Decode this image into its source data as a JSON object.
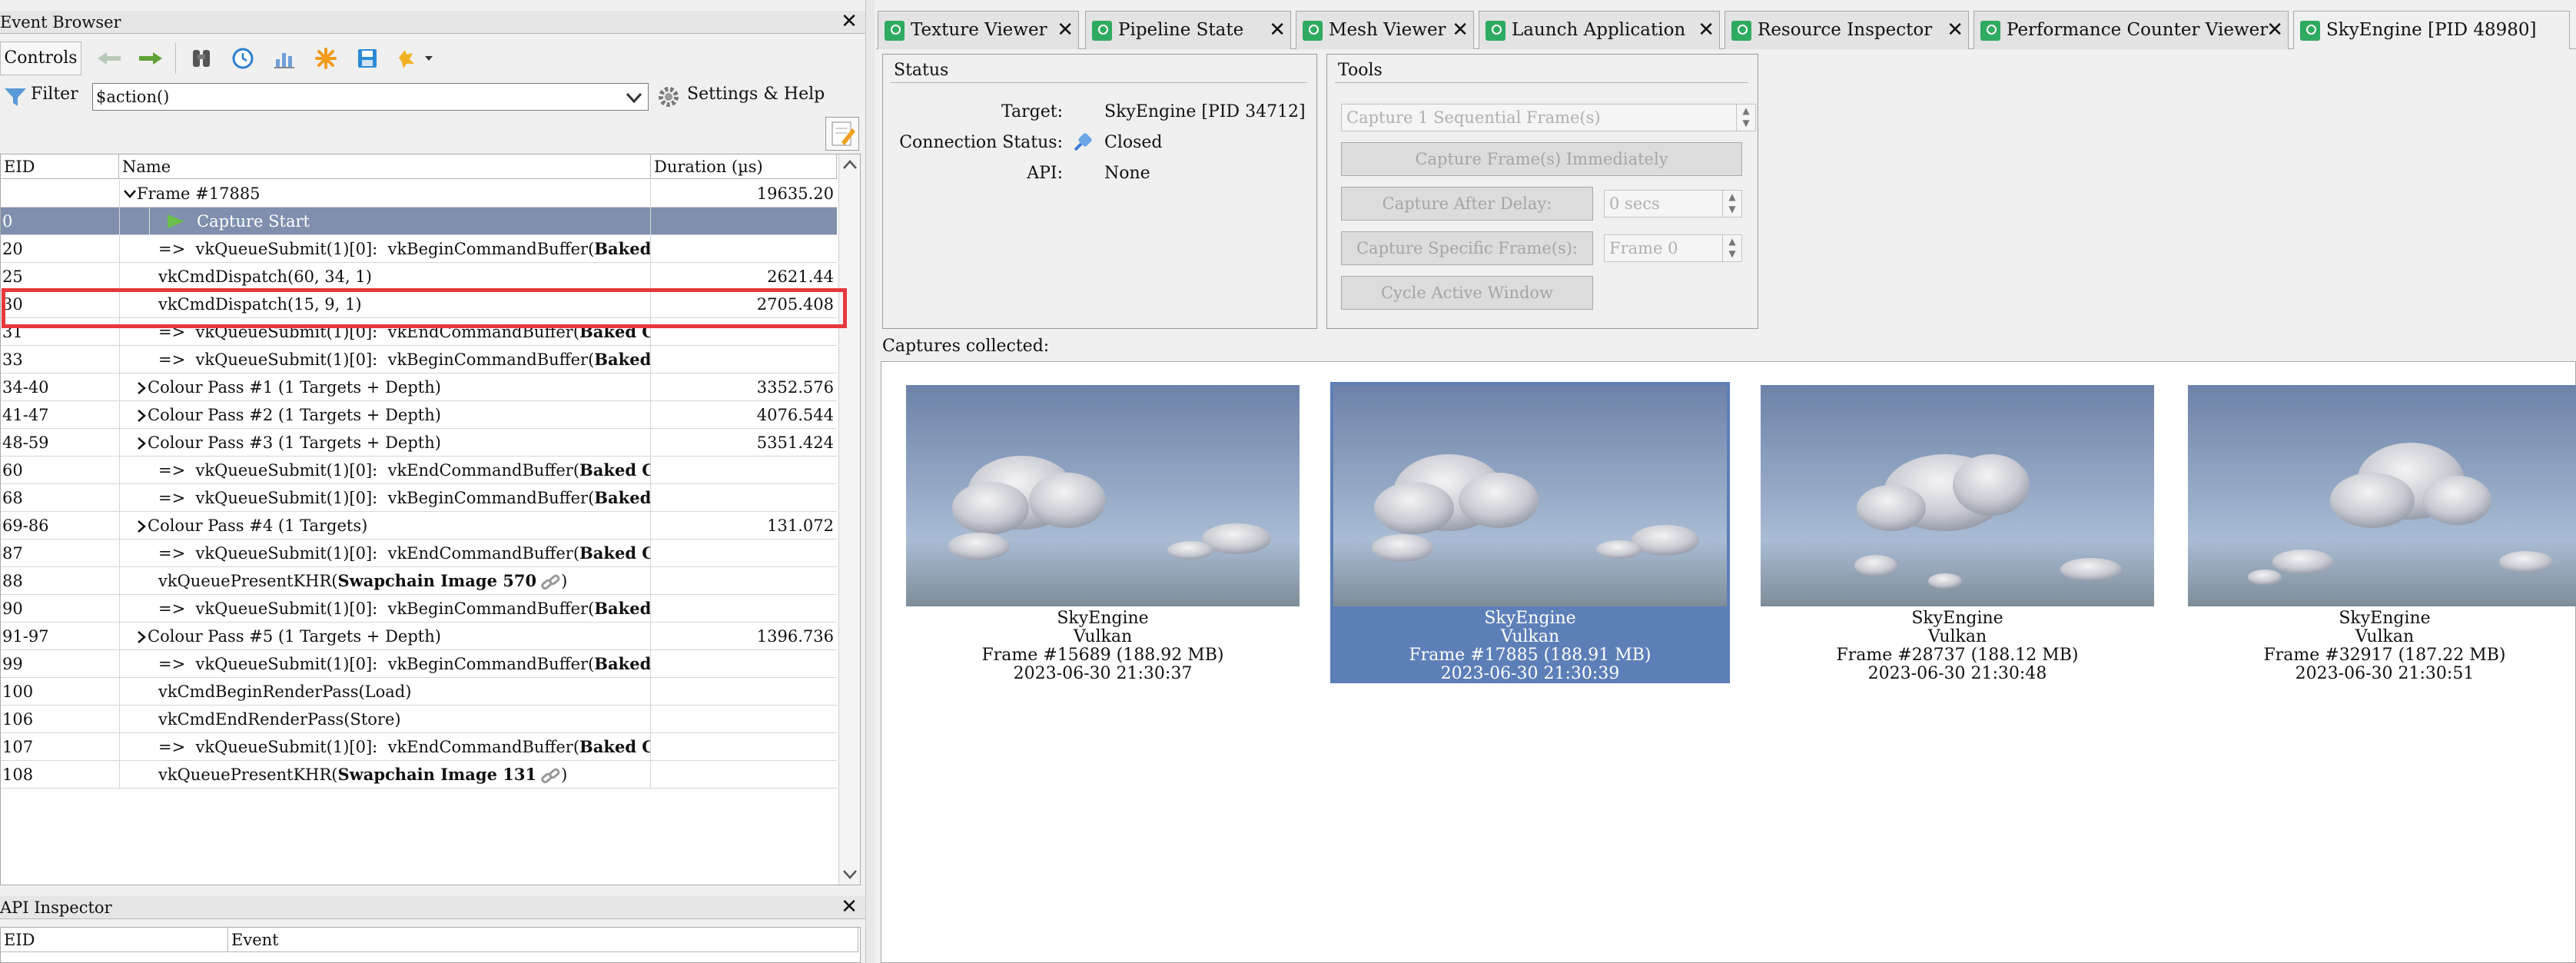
{
  "event_browser": {
    "title": "Event Browser",
    "controls_label": "Controls",
    "filter_label": "Filter",
    "filter_value": "$action()",
    "settings_label": "Settings & Help",
    "columns": [
      "EID",
      "Name",
      "Duration (µs)"
    ],
    "rows": [
      {
        "eid": "",
        "name": "Frame #17885",
        "dur": "19635.20",
        "type": "frame"
      },
      {
        "eid": "0",
        "name": "Capture Start",
        "dur": "",
        "type": "capture"
      },
      {
        "eid": "20",
        "name": "=>  vkQueueSubmit(1)[0]:  vkBeginCommandBuffer(",
        "bold": "Baked",
        "dur": "",
        "type": "sub"
      },
      {
        "eid": "25",
        "name": "vkCmdDispatch(60, 34, 1)",
        "dur": "2621.44",
        "type": "plain"
      },
      {
        "eid": "30",
        "name": "vkCmdDispatch(15, 9, 1)",
        "dur": "2705.408",
        "type": "plain"
      },
      {
        "eid": "31",
        "name": "=>  vkQueueSubmit(1)[0]:  vkEndCommandBuffer(",
        "bold": "Baked Co",
        "dur": "",
        "type": "sub"
      },
      {
        "eid": "33",
        "name": "=>  vkQueueSubmit(1)[0]:  vkBeginCommandBuffer(",
        "bold": "Baked",
        "dur": "",
        "type": "sub"
      },
      {
        "eid": "34-40",
        "name": "Colour Pass #1 (1 Targets + Depth)",
        "dur": "3352.576",
        "type": "pass"
      },
      {
        "eid": "41-47",
        "name": "Colour Pass #2 (1 Targets + Depth)",
        "dur": "4076.544",
        "type": "pass"
      },
      {
        "eid": "48-59",
        "name": "Colour Pass #3 (1 Targets + Depth)",
        "dur": "5351.424",
        "type": "pass"
      },
      {
        "eid": "60",
        "name": "=>  vkQueueSubmit(1)[0]:  vkEndCommandBuffer(",
        "bold": "Baked Co",
        "dur": "",
        "type": "sub"
      },
      {
        "eid": "68",
        "name": "=>  vkQueueSubmit(1)[0]:  vkBeginCommandBuffer(",
        "bold": "Baked",
        "dur": "",
        "type": "sub"
      },
      {
        "eid": "69-86",
        "name": "Colour Pass #4 (1 Targets)",
        "dur": "131.072",
        "type": "pass"
      },
      {
        "eid": "87",
        "name": "=>  vkQueueSubmit(1)[0]:  vkEndCommandBuffer(",
        "bold": "Baked Co",
        "dur": "",
        "type": "sub"
      },
      {
        "eid": "88",
        "name": "vkQueuePresentKHR(",
        "bold": "Swapchain Image 570",
        "tail": ")",
        "dur": "",
        "type": "present"
      },
      {
        "eid": "90",
        "name": "=>  vkQueueSubmit(1)[0]:  vkBeginCommandBuffer(",
        "bold": "Baked",
        "dur": "",
        "type": "sub"
      },
      {
        "eid": "91-97",
        "name": "Colour Pass #5 (1 Targets + Depth)",
        "dur": "1396.736",
        "type": "pass"
      },
      {
        "eid": "99",
        "name": "=>  vkQueueSubmit(1)[0]:  vkBeginCommandBuffer(",
        "bold": "Baked",
        "dur": "",
        "type": "sub"
      },
      {
        "eid": "100",
        "name": "vkCmdBeginRenderPass(Load)",
        "dur": "",
        "type": "plain"
      },
      {
        "eid": "106",
        "name": "vkCmdEndRenderPass(Store)",
        "dur": "",
        "type": "plain"
      },
      {
        "eid": "107",
        "name": "=>  vkQueueSubmit(1)[0]:  vkEndCommandBuffer(",
        "bold": "Baked Co",
        "dur": "",
        "type": "sub"
      },
      {
        "eid": "108",
        "name": "vkQueuePresentKHR(",
        "bold": "Swapchain Image 131",
        "tail": ")",
        "dur": "",
        "type": "present"
      }
    ]
  },
  "api_inspector": {
    "title": "API Inspector",
    "columns": [
      "EID",
      "Event"
    ]
  },
  "tabs": [
    {
      "label": "Texture Viewer"
    },
    {
      "label": "Pipeline State"
    },
    {
      "label": "Mesh Viewer"
    },
    {
      "label": "Launch Application"
    },
    {
      "label": "Resource Inspector"
    },
    {
      "label": "Performance Counter Viewer"
    },
    {
      "label": "SkyEngine [PID 48980]"
    }
  ],
  "status": {
    "title": "Status",
    "target_label": "Target:",
    "target_value": "SkyEngine [PID 34712]",
    "connection_label": "Connection Status:",
    "connection_value": "Closed",
    "api_label": "API:",
    "api_value": "None"
  },
  "tools": {
    "title": "Tools",
    "sequential_value": "Capture 1 Sequential Frame(s)",
    "capture_now_label": "Capture Frame(s) Immediately",
    "capture_delay_label": "Capture After Delay:",
    "delay_value": "0 secs",
    "capture_specific_label": "Capture Specific Frame(s):",
    "frame_value": "Frame 0",
    "cycle_window_label": "Cycle Active Window"
  },
  "captures_label": "Captures collected:",
  "captures": [
    {
      "app": "SkyEngine",
      "api": "Vulkan",
      "frame": "Frame #15689 (188.92 MB)",
      "time": "2023-06-30 21:30:37",
      "selected": false
    },
    {
      "app": "SkyEngine",
      "api": "Vulkan",
      "frame": "Frame #17885 (188.91 MB)",
      "time": "2023-06-30 21:30:39",
      "selected": true
    },
    {
      "app": "SkyEngine",
      "api": "Vulkan",
      "frame": "Frame #28737 (188.12 MB)",
      "time": "2023-06-30 21:30:48",
      "selected": false
    },
    {
      "app": "SkyEngine",
      "api": "Vulkan",
      "frame": "Frame #32917 (187.22 MB)",
      "time": "2023-06-30 21:30:51",
      "selected": false
    }
  ],
  "colors": {
    "accent_selection": "#7f8fad",
    "highlight_box": "#e8383d",
    "tab_icon": "#2eaa61"
  }
}
